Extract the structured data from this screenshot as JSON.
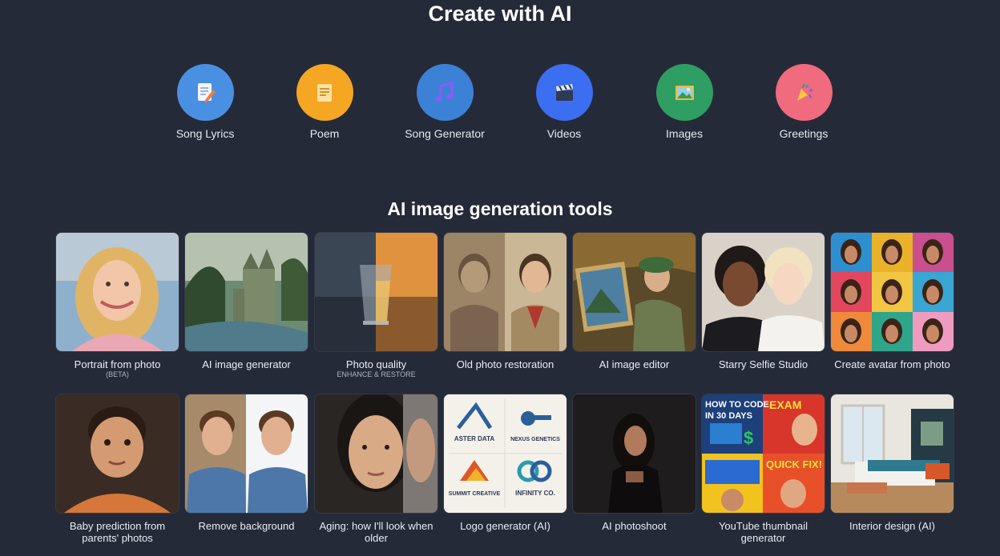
{
  "create_section": {
    "title": "Create with AI",
    "items": [
      {
        "label": "Song Lyrics",
        "icon": "document-pen-icon",
        "color": "#4a90e2"
      },
      {
        "label": "Poem",
        "icon": "note-icon",
        "color": "#f5a623"
      },
      {
        "label": "Song Generator",
        "icon": "music-note-icon",
        "color": "#3b82d6"
      },
      {
        "label": "Videos",
        "icon": "clapperboard-icon",
        "color": "#3b6ef0"
      },
      {
        "label": "Images",
        "icon": "picture-icon",
        "color": "#2e9e63"
      },
      {
        "label": "Greetings",
        "icon": "party-popper-icon",
        "color": "#f06b7d"
      }
    ]
  },
  "tools_section": {
    "title": "AI image generation tools",
    "row1": [
      {
        "label": "Portrait from photo",
        "sub": "(BETA)"
      },
      {
        "label": "AI image generator"
      },
      {
        "label": "Photo quality",
        "sub": "ENHANCE & RESTORE"
      },
      {
        "label": "Old photo restoration"
      },
      {
        "label": "AI image editor"
      },
      {
        "label": "Starry Selfie Studio"
      },
      {
        "label": "Create avatar from photo"
      }
    ],
    "row2": [
      {
        "label": "Baby prediction from parents' photos"
      },
      {
        "label": "Remove background"
      },
      {
        "label": "Aging: how I'll look when older"
      },
      {
        "label": "Logo generator (AI)",
        "logos": [
          "ASTER DATA",
          "NEXUS GENETICS",
          "SUMMIT CREATIVE",
          "INFINITY CO."
        ]
      },
      {
        "label": "AI photoshoot"
      },
      {
        "label": "YouTube thumbnail generator",
        "thumb_texts": [
          "HOW TO CODE",
          "IN 30 DAYS",
          "EXAM",
          "QUICK FIX!"
        ]
      },
      {
        "label": "Interior design (AI)"
      }
    ]
  }
}
